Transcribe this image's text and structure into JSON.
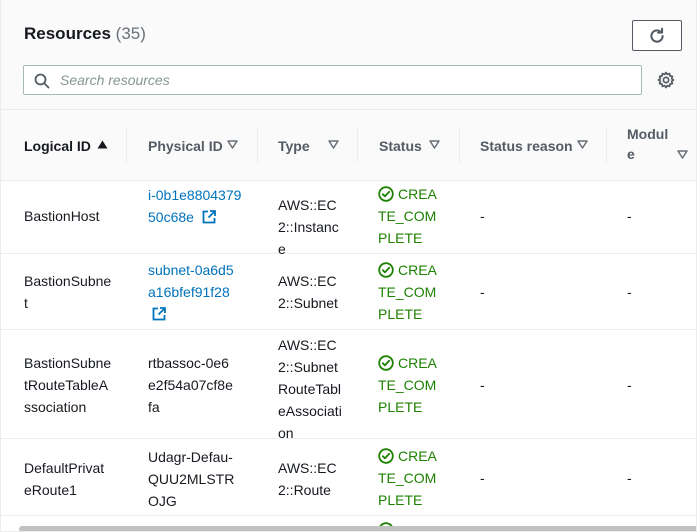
{
  "header": {
    "title": "Resources",
    "count": "(35)",
    "refresh_icon": "refresh-icon",
    "settings_icon": "gear-icon"
  },
  "search": {
    "placeholder": "Search resources",
    "value": ""
  },
  "columns": {
    "logical_id": "Logical ID",
    "physical_id": "Physical ID",
    "type": "Type",
    "status": "Status",
    "status_reason": "Status reason",
    "module": "Module"
  },
  "rows": [
    {
      "logical_id": "BastionHost",
      "physical_id": "i-0b1e880437950c68e",
      "type": "AWS::EC2::Instance",
      "status": "CREATE_COMPLETE",
      "status_reason": "-",
      "module": "-"
    },
    {
      "logical_id": "BastionSubnet",
      "physical_id": "subnet-0a6d5a16bfef91f28",
      "type": "AWS::EC2::Subnet",
      "status": "CREATE_COMPLETE",
      "status_reason": "-",
      "module": "-"
    },
    {
      "logical_id": "BastionSubnetRouteTableAssociation",
      "physical_id": "rtbassoc-0e6e2f54a07cf8efa",
      "type": "AWS::EC2::SubnetRouteTableAssociation",
      "status": "CREATE_COMPLETE",
      "status_reason": "-",
      "module": "-"
    },
    {
      "logical_id": "DefaultPrivateRoute1",
      "physical_id": "Udagr-Defau-QUU2MLSTROJG",
      "type": "AWS::EC2::Route",
      "status": "CREATE_COMPLETE",
      "status_reason": "-",
      "module": "-"
    }
  ],
  "colors": {
    "link": "#0073bb",
    "success": "#1d8102",
    "header_bg": "#fafafa"
  }
}
